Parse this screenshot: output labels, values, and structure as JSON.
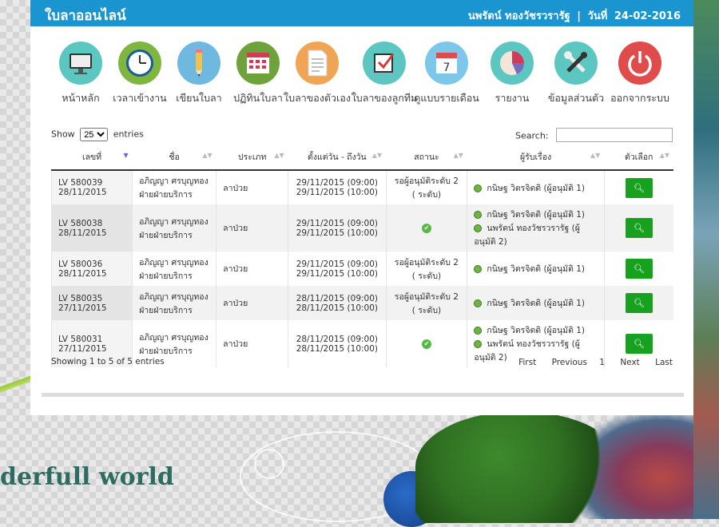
{
  "header": {
    "app_title": "ใบลาออนไลน์",
    "user_name": "นพรัตน์ ทองวัชรวรารัฐ",
    "separator": "|",
    "date_label": "วันที่",
    "date_value": "24-02-2016"
  },
  "menu": [
    {
      "label": "หน้าหลัก",
      "icon": "monitor-icon",
      "color": "#5cc6c0"
    },
    {
      "label": "เวลาเข้างาน",
      "icon": "clock-icon",
      "color": "#7fb63f"
    },
    {
      "label": "เขียนใบลา",
      "icon": "pencil-icon",
      "color": "#6fb8e0"
    },
    {
      "label": "ปฏิทินใบลา",
      "icon": "calendar-grid-icon",
      "color": "#6ea33b"
    },
    {
      "label": "ใบลาของตัวเอง",
      "icon": "document-icon",
      "color": "#f0a555"
    },
    {
      "label": "ใบลาของลูกทีม",
      "icon": "checkbox-icon",
      "color": "#5cc6c0"
    },
    {
      "label": "ดูแบบรายเดือน",
      "icon": "calendar-7-icon",
      "color": "#7cc7ea"
    },
    {
      "label": "รายงาน",
      "icon": "pie-chart-icon",
      "color": "#5cc6c0"
    },
    {
      "label": "ข้อมูลส่วนตัว",
      "icon": "tools-icon",
      "color": "#5cc6c0"
    },
    {
      "label": "ออกจากระบบ",
      "icon": "power-icon",
      "color": "#e04b4b"
    }
  ],
  "table_controls": {
    "show_label": "Show",
    "entries_value": "25",
    "entries_label": "entries",
    "search_label": "Search:"
  },
  "columns": [
    "เลขที่",
    "ชื่อ",
    "ประเภท",
    "ตั้งแต่วัน - ถึงวัน",
    "สถานะ",
    "ผู้รับเรื่อง",
    "ตัวเลือก"
  ],
  "rows": [
    {
      "no": "LV 580039",
      "date": "28/11/2015",
      "name": "อภิญญา ศรบุญทอง",
      "dept": "ฝ่ายฝ่ายบริการ",
      "type": "ลาป่วย",
      "from": "29/11/2015 (09:00)",
      "to": "29/11/2015 (10:00)",
      "status_l1": "รอผู้อนุมัติระดับ 2",
      "status_l2": "( ระดับ)",
      "approved": false,
      "approvers": [
        "กนิษฐ วิตรจิตติ (ผู้อนุมัติ 1)"
      ]
    },
    {
      "no": "LV 580038",
      "date": "28/11/2015",
      "name": "อภิญญา ศรบุญทอง",
      "dept": "ฝ่ายฝ่ายบริการ",
      "type": "ลาป่วย",
      "from": "29/11/2015 (09:00)",
      "to": "29/11/2015 (10:00)",
      "status_l1": "",
      "status_l2": "",
      "approved": true,
      "approvers": [
        "กนิษฐ วิตรจิตติ (ผู้อนุมัติ 1)",
        "นพรัตน์ ทองวัชรวรารัฐ (ผู้อนุมัติ 2)"
      ]
    },
    {
      "no": "LV 580036",
      "date": "28/11/2015",
      "name": "อภิญญา ศรบุญทอง",
      "dept": "ฝ่ายฝ่ายบริการ",
      "type": "ลาป่วย",
      "from": "29/11/2015 (09:00)",
      "to": "29/11/2015 (10:00)",
      "status_l1": "รอผู้อนุมัติระดับ 2",
      "status_l2": "( ระดับ)",
      "approved": false,
      "approvers": [
        "กนิษฐ วิตรจิตติ (ผู้อนุมัติ 1)"
      ]
    },
    {
      "no": "LV 580035",
      "date": "27/11/2015",
      "name": "อภิญญา ศรบุญทอง",
      "dept": "ฝ่ายฝ่ายบริการ",
      "type": "ลาป่วย",
      "from": "28/11/2015 (09:00)",
      "to": "28/11/2015 (10:00)",
      "status_l1": "รอผู้อนุมัติระดับ 2",
      "status_l2": "( ระดับ)",
      "approved": false,
      "approvers": [
        "กนิษฐ วิตรจิตติ (ผู้อนุมัติ 1)"
      ]
    },
    {
      "no": "LV 580031",
      "date": "27/11/2015",
      "name": "อภิญญา ศรบุญทอง",
      "dept": "ฝ่ายฝ่ายบริการ",
      "type": "ลาป่วย",
      "from": "28/11/2015 (09:00)",
      "to": "28/11/2015 (10:00)",
      "status_l1": "",
      "status_l2": "",
      "approved": true,
      "approvers": [
        "กนิษฐ วิตรจิตติ (ผู้อนุมัติ 1)",
        "นพรัตน์ ทองวัชรวรารัฐ (ผู้อนุมัติ 2)"
      ]
    }
  ],
  "footer": {
    "info": "Showing 1 to 5 of 5 entries",
    "first": "First",
    "previous": "Previous",
    "page": "1",
    "next": "Next",
    "last": "Last"
  },
  "background": {
    "slogan": "derfull world"
  }
}
